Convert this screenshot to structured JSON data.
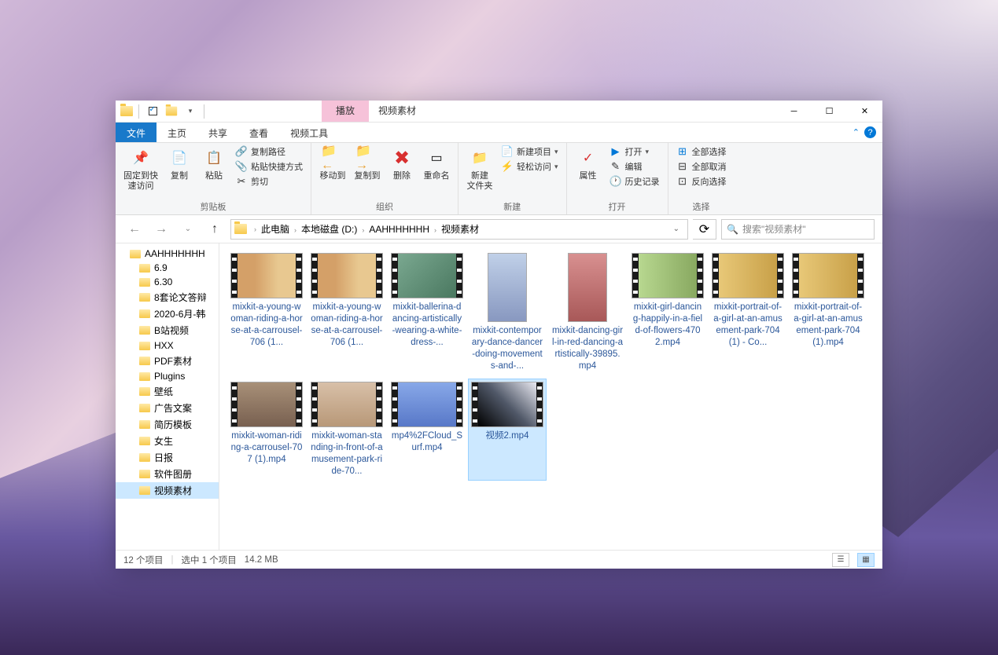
{
  "titlebar": {
    "ctx_tab": "播放",
    "folder_name": "视频素材"
  },
  "menu": {
    "file": "文件",
    "home": "主页",
    "share": "共享",
    "view": "查看",
    "video": "视频工具"
  },
  "ribbon": {
    "pin": "固定到快\n速访问",
    "copy": "复制",
    "paste": "粘贴",
    "copy_path": "复制路径",
    "paste_shortcut": "粘贴快捷方式",
    "cut": "剪切",
    "group_clipboard": "剪贴板",
    "move_to": "移动到",
    "copy_to": "复制到",
    "delete": "删除",
    "rename": "重命名",
    "group_organize": "组织",
    "new_folder": "新建\n文件夹",
    "new_item": "新建项目",
    "easy_access": "轻松访问",
    "group_new": "新建",
    "properties": "属性",
    "open": "打开",
    "edit": "编辑",
    "history": "历史记录",
    "group_open": "打开",
    "select_all": "全部选择",
    "select_none": "全部取消",
    "invert": "反向选择",
    "group_select": "选择"
  },
  "breadcrumb": [
    "此电脑",
    "本地磁盘 (D:)",
    "AAHHHHHHH",
    "视频素材"
  ],
  "search_placeholder": "搜索\"视频素材\"",
  "sidebar": [
    {
      "label": "AAHHHHHHH",
      "level": 1
    },
    {
      "label": "6.9",
      "level": 2
    },
    {
      "label": "6.30",
      "level": 2
    },
    {
      "label": "8套论文答辩",
      "level": 2
    },
    {
      "label": "2020-6月-韩",
      "level": 2
    },
    {
      "label": "B站视频",
      "level": 2
    },
    {
      "label": "HXX",
      "level": 2
    },
    {
      "label": "PDF素材",
      "level": 2
    },
    {
      "label": "Plugins",
      "level": 2
    },
    {
      "label": "壁纸",
      "level": 2
    },
    {
      "label": "广告文案",
      "level": 2
    },
    {
      "label": "简历模板",
      "level": 2
    },
    {
      "label": "女生",
      "level": 2
    },
    {
      "label": "日报",
      "level": 2
    },
    {
      "label": "软件图册",
      "level": 2
    },
    {
      "label": "视频素材",
      "level": 2,
      "selected": true
    }
  ],
  "files": [
    {
      "label": "mixkit-a-young-woman-riding-a-horse-at-a-carrousel-706 (1...",
      "th": "th1"
    },
    {
      "label": "mixkit-a-young-woman-riding-a-horse-at-a-carrousel-706 (1...",
      "th": "th1"
    },
    {
      "label": "mixkit-ballerina-dancing-artistically-wearing-a-white-dress-...",
      "th": "th2"
    },
    {
      "label": "mixkit-contemporary-dance-dancer-doing-movements-and-...",
      "th": "th3",
      "tall": true
    },
    {
      "label": "mixkit-dancing-girl-in-red-dancing-artistically-39895.mp4",
      "th": "th4",
      "tall": true
    },
    {
      "label": "mixkit-girl-dancing-happily-in-a-field-of-flowers-4702.mp4",
      "th": "th5"
    },
    {
      "label": "mixkit-portrait-of-a-girl-at-an-amusement-park-704 (1) - Co...",
      "th": "th6"
    },
    {
      "label": "mixkit-portrait-of-a-girl-at-an-amusement-park-704 (1).mp4",
      "th": "th6"
    },
    {
      "label": "mixkit-woman-riding-a-carrousel-707 (1).mp4",
      "th": "th7"
    },
    {
      "label": "mixkit-woman-standing-in-front-of-amusement-park-ride-70...",
      "th": "th8"
    },
    {
      "label": "mp4%2FCloud_Surf.mp4",
      "th": "th9"
    },
    {
      "label": "视频2.mp4",
      "th": "th10",
      "selected": true
    }
  ],
  "status": {
    "items": "12 个项目",
    "selected": "选中 1 个项目",
    "size": "14.2 MB"
  }
}
